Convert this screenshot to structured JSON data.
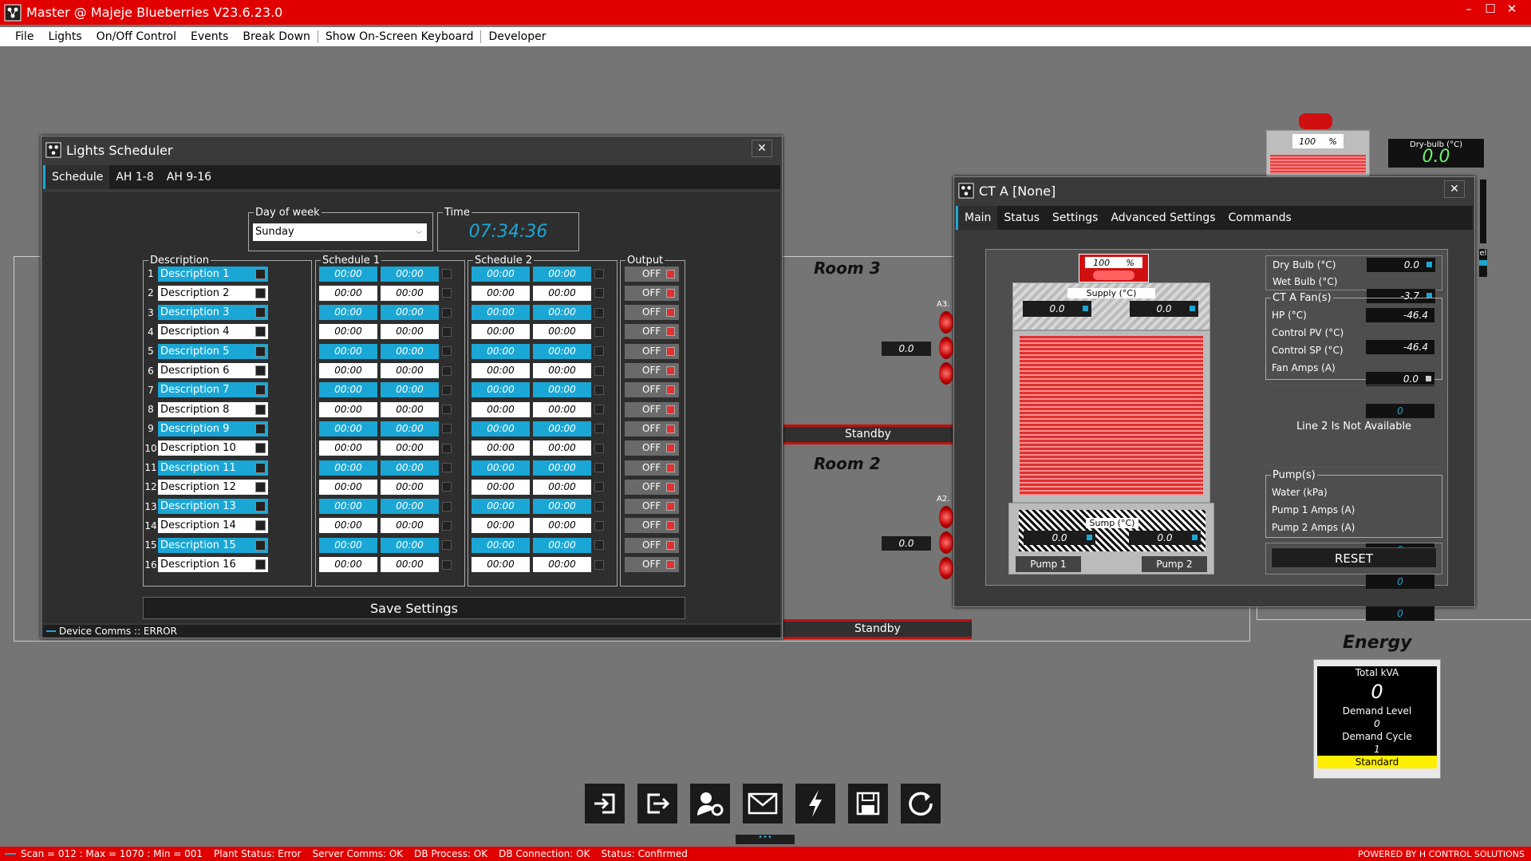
{
  "app": {
    "title": "Master @ Majeje Blueberries V23.6.23.0",
    "menu": [
      "File",
      "Lights",
      "On/Off Control",
      "Events",
      "Break Down",
      "Show On-Screen Keyboard",
      "Developer"
    ]
  },
  "background": {
    "rooms": [
      {
        "label": "Room 3",
        "value": "0.0",
        "panel_id": "A3.",
        "state": "Standby"
      },
      {
        "label": "Room 2",
        "value": "0.0",
        "panel_id": "A2.",
        "state": "Standby"
      }
    ],
    "top_unit": {
      "percent_value": "100",
      "percent_unit": "%"
    },
    "drybulb": {
      "label": "Dry-bulb (°C)",
      "value": "0.0"
    },
    "side_label": "el",
    "energy": {
      "title": "Energy",
      "total_kva_label": "Total kVA",
      "total_kva": "0",
      "demand_level_label": "Demand Level",
      "demand_level": "0",
      "demand_cycle_label": "Demand Cycle",
      "demand_cycle": "1",
      "mode": "Standard"
    }
  },
  "lights": {
    "title": "Lights Scheduler",
    "tabs": [
      "Schedule",
      "AH 1-8",
      "AH 9-16"
    ],
    "day_label": "Day of week",
    "day_value": "Sunday",
    "time_label": "Time",
    "time_value": "07:34:36",
    "col_description": "Description",
    "col_schedule1": "Schedule 1",
    "col_schedule2": "Schedule 2",
    "col_output": "Output",
    "rows": [
      {
        "n": "1",
        "desc": "Description 1",
        "s1a": "00:00",
        "s1b": "00:00",
        "s2a": "00:00",
        "s2b": "00:00",
        "out": "OFF"
      },
      {
        "n": "2",
        "desc": "Description 2",
        "s1a": "00:00",
        "s1b": "00:00",
        "s2a": "00:00",
        "s2b": "00:00",
        "out": "OFF"
      },
      {
        "n": "3",
        "desc": "Description 3",
        "s1a": "00:00",
        "s1b": "00:00",
        "s2a": "00:00",
        "s2b": "00:00",
        "out": "OFF"
      },
      {
        "n": "4",
        "desc": "Description 4",
        "s1a": "00:00",
        "s1b": "00:00",
        "s2a": "00:00",
        "s2b": "00:00",
        "out": "OFF"
      },
      {
        "n": "5",
        "desc": "Description 5",
        "s1a": "00:00",
        "s1b": "00:00",
        "s2a": "00:00",
        "s2b": "00:00",
        "out": "OFF"
      },
      {
        "n": "6",
        "desc": "Description 6",
        "s1a": "00:00",
        "s1b": "00:00",
        "s2a": "00:00",
        "s2b": "00:00",
        "out": "OFF"
      },
      {
        "n": "7",
        "desc": "Description 7",
        "s1a": "00:00",
        "s1b": "00:00",
        "s2a": "00:00",
        "s2b": "00:00",
        "out": "OFF"
      },
      {
        "n": "8",
        "desc": "Description 8",
        "s1a": "00:00",
        "s1b": "00:00",
        "s2a": "00:00",
        "s2b": "00:00",
        "out": "OFF"
      },
      {
        "n": "9",
        "desc": "Description 9",
        "s1a": "00:00",
        "s1b": "00:00",
        "s2a": "00:00",
        "s2b": "00:00",
        "out": "OFF"
      },
      {
        "n": "10",
        "desc": "Description 10",
        "s1a": "00:00",
        "s1b": "00:00",
        "s2a": "00:00",
        "s2b": "00:00",
        "out": "OFF"
      },
      {
        "n": "11",
        "desc": "Description 11",
        "s1a": "00:00",
        "s1b": "00:00",
        "s2a": "00:00",
        "s2b": "00:00",
        "out": "OFF"
      },
      {
        "n": "12",
        "desc": "Description 12",
        "s1a": "00:00",
        "s1b": "00:00",
        "s2a": "00:00",
        "s2b": "00:00",
        "out": "OFF"
      },
      {
        "n": "13",
        "desc": "Description 13",
        "s1a": "00:00",
        "s1b": "00:00",
        "s2a": "00:00",
        "s2b": "00:00",
        "out": "OFF"
      },
      {
        "n": "14",
        "desc": "Description 14",
        "s1a": "00:00",
        "s1b": "00:00",
        "s2a": "00:00",
        "s2b": "00:00",
        "out": "OFF"
      },
      {
        "n": "15",
        "desc": "Description 15",
        "s1a": "00:00",
        "s1b": "00:00",
        "s2a": "00:00",
        "s2b": "00:00",
        "out": "OFF"
      },
      {
        "n": "16",
        "desc": "Description 16",
        "s1a": "00:00",
        "s1b": "00:00",
        "s2a": "00:00",
        "s2b": "00:00",
        "out": "OFF"
      }
    ],
    "save_label": "Save Settings",
    "status": "Device Comms :: ERROR"
  },
  "cta": {
    "title": "CT A [None]",
    "tabs": [
      "Main",
      "Status",
      "Settings",
      "Advanced Settings",
      "Commands"
    ],
    "fan_percent": "100",
    "fan_unit": "%",
    "supply_label": "Supply (°C)",
    "supply_values": [
      "0.0",
      "0.0"
    ],
    "sump_label": "Sump (°C)",
    "sump_values": [
      "0.0",
      "0.0"
    ],
    "pump1_label": "Pump 1",
    "pump2_label": "Pump 2",
    "dry_bulb_label": "Dry Bulb (°C)",
    "dry_bulb": "0.0",
    "wet_bulb_label": "Wet Bulb (°C)",
    "wet_bulb": "-3.7",
    "fans_group": "CT A Fan(s)",
    "hp_label": "HP (°C)",
    "hp": "-46.4",
    "cpv_label": "Control PV (°C)",
    "cpv": "-46.4",
    "csp_label": "Control SP (°C)",
    "csp": "0.0",
    "fan_amps_label": "Fan Amps (A)",
    "fan_amps": "0",
    "line2_msg": "Line 2 Is Not Available",
    "pumps_group": "Pump(s)",
    "water_label": "Water (kPa)",
    "water": "0",
    "pump1_amps_label": "Pump 1 Amps (A)",
    "pump1_amps": "0",
    "pump2_amps_label": "Pump 2 Amps (A)",
    "pump2_amps": "0",
    "reset_label": "RESET"
  },
  "statusbar": {
    "scan": "Scan = 012 : Max = 1070 : Min = 001",
    "plant": "Plant Status: Error",
    "server": "Server Comms: OK",
    "db_process": "DB Process:  OK",
    "db_conn": "DB Connection:  OK",
    "status": "Status:  Confirmed",
    "powered": "POWERED BY H CONTROL SOLUTIONS"
  },
  "colors": {
    "accent": "#1aa7d5",
    "alert": "#e00000",
    "highlight": "#ffee00"
  }
}
